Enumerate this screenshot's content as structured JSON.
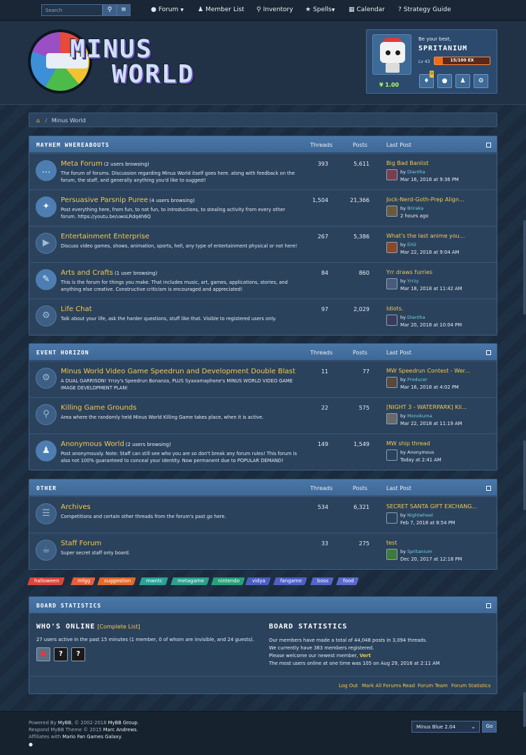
{
  "nav": {
    "search_placeholder": "Search",
    "items": [
      {
        "label": "Forum",
        "icon": "chat-bubbles-icon",
        "dropdown": true
      },
      {
        "label": "Member List",
        "icon": "users-icon",
        "dropdown": false
      },
      {
        "label": "Inventory",
        "icon": "flask-icon",
        "dropdown": false
      },
      {
        "label": "Spells",
        "icon": "star-icon",
        "dropdown": true
      },
      {
        "label": "Calendar",
        "icon": "calendar-icon",
        "dropdown": false
      },
      {
        "label": "Strategy Guide",
        "icon": "question-icon",
        "dropdown": false
      }
    ]
  },
  "logo": {
    "line1": "MINUS",
    "line2": "WORLD"
  },
  "user": {
    "tagline": "Be your best,",
    "name": "SPRITANIUM",
    "level": "Lv 43",
    "xp_text": "15/100 EX",
    "xp_fraction": 0.15,
    "money": "1.00",
    "notification_count": "0"
  },
  "breadcrumb": {
    "home_icon": "home-icon",
    "current": "Minus World"
  },
  "columns": {
    "threads": "Threads",
    "posts": "Posts",
    "last_post": "Last Post"
  },
  "sections": [
    {
      "title": "MAYHEM WHEREABOUTS",
      "forums": [
        {
          "name": "Meta Forum",
          "browsing": "(2 users browsing)",
          "desc": "The forum of forums. Discussion regarding Minus World itself goes here. along with feedback on the forum, the staff, and generally anything you'd like to suggest!",
          "threads": "393",
          "posts": "5,611",
          "lp_title": "Big Bad Banlist",
          "lp_user": "Diantha",
          "lp_date": "Mar 16, 2018 at 9:36 PM",
          "icon": "chat-icon"
        },
        {
          "name": "Persuasive Parsnip Puree",
          "browsing": "(4 users browsing)",
          "desc": "Post everything here, from fun, to not fun, to introductions, to stealing activity from every other forum. https://youtu.be/uwoLRdq4h6Q",
          "threads": "1,504",
          "posts": "21,366",
          "lp_title": "Jock-Nerd-Goth-Prep Align...",
          "lp_user": "Briraka",
          "lp_date": "2 hours ago",
          "icon": "magic-wand-icon"
        },
        {
          "name": "Entertainment Enterprise",
          "browsing": "",
          "desc": "Discuss video games, shows, animation, sports, hell, any type of entertainment physical or not here!",
          "threads": "267",
          "posts": "5,386",
          "lp_title": "What's the last anime you...",
          "lp_user": "EH2",
          "lp_date": "Mar 22, 2018 at 9:04 AM",
          "icon": "play-icon"
        },
        {
          "name": "Arts and Crafts",
          "browsing": "(1 user browsing)",
          "desc": "This is the forum for things you make. That includes music, art, games, applications, stories, and anything else creative. Constructive criticism is encouraged and appreciated!",
          "threads": "84",
          "posts": "860",
          "lp_title": "Yrr draws furries",
          "lp_user": "Yrrzy",
          "lp_date": "Mar 18, 2018 at 11:42 AM",
          "icon": "paintbrush-icon"
        },
        {
          "name": "Life Chat",
          "browsing": "",
          "desc": "Talk about your life, ask the harder questions, stuff like that. Visible to registered users only.",
          "threads": "97",
          "posts": "2,029",
          "lp_title": "Idiots.",
          "lp_user": "Diantha",
          "lp_date": "Mar 20, 2018 at 10:04 PM",
          "icon": "gear-icon"
        }
      ]
    },
    {
      "title": "EVENT HORIZON",
      "forums": [
        {
          "name": "Minus World Video Game Speedrun and Development Double Blast",
          "browsing": "",
          "desc": "A DUAL GARRISON! Yrrzy's Speedrun Bonanza, PLUS Syaxamaphone's MINUS WORLD VIDEO GAME IMAGE DEVELOPMENT PLAN!",
          "threads": "11",
          "posts": "77",
          "lp_title": "MW Speedrun Contest - Wer...",
          "lp_user": "Producer",
          "lp_date": "Mar 16, 2018 at 4:02 PM",
          "icon": "gear-icon"
        },
        {
          "name": "Killing Game Grounds",
          "browsing": "",
          "desc": "Area where the randomly held Minus World Killing Game takes place, when it is active.",
          "threads": "22",
          "posts": "575",
          "lp_title": "[NIGHT 3 - WATERPARK] Kil...",
          "lp_user": "Monokuma",
          "lp_date": "Mar 22, 2018 at 11:19 AM",
          "icon": "search-icon"
        },
        {
          "name": "Anonymous World",
          "browsing": "(2 users browsing)",
          "desc": "Post anonymously. Note: Staff can still see who you are so don't break any forum rules! This forum is also not 100% guaranteed to conceal your identity. Now permanent due to POPULAR DEMAND!",
          "threads": "149",
          "posts": "1,549",
          "lp_title": "MW ship thread",
          "lp_user": "Anonymous",
          "lp_date": "Today at 2:41 AM",
          "icon": "spy-icon"
        }
      ]
    },
    {
      "title": "OTHER",
      "forums": [
        {
          "name": "Archives",
          "browsing": "",
          "desc": "Competitions and certain other threads from the forum's past go here.",
          "threads": "534",
          "posts": "6,321",
          "lp_title": "SECRET SANTA GIFT EXCHANG...",
          "lp_user": "Nightwheel",
          "lp_date": "Feb 7, 2018 at 8:54 PM",
          "icon": "document-icon"
        },
        {
          "name": "Staff Forum",
          "browsing": "",
          "desc": "Super secret staff only board.",
          "threads": "33",
          "posts": "275",
          "lp_title": "test",
          "lp_user": "Spritanium",
          "lp_date": "Dec 20, 2017 at 12:18 PM",
          "icon": "coffee-icon"
        }
      ]
    }
  ],
  "tags": [
    {
      "label": "halloween",
      "color": "#d9463b"
    },
    {
      "label": "mfgg",
      "color": "#e2603a"
    },
    {
      "label": "suggestion",
      "color": "#e26a2c"
    },
    {
      "label": "mwntc",
      "color": "#2aa198"
    },
    {
      "label": "metagame",
      "color": "#2c9f8f"
    },
    {
      "label": "nintendo",
      "color": "#27a07a"
    },
    {
      "label": "vidya",
      "color": "#4a5fc1"
    },
    {
      "label": "fangame",
      "color": "#4d62c4"
    },
    {
      "label": "boss",
      "color": "#5465c8"
    },
    {
      "label": "food",
      "color": "#5a6acb"
    }
  ],
  "stats": {
    "title": "BOARD STATISTICS",
    "online_title": "WHO'S ONLINE",
    "complete_list": "[Complete List]",
    "online_text": "27 users active in the past 15 minutes (1 member, 0 of whom are invisible, and 24 guests).",
    "board_title": "BOARD STATISTICS",
    "line1": "Our members have made a total of 44,048 posts in 3,094 threads.",
    "line2": "We currently have 383 members registered.",
    "line3_prefix": "Please welcome our newest member, ",
    "newest_member": "Vert",
    "line4": "The most users online at one time was 105 on Aug 29, 2016 at 2:11 AM",
    "links": [
      "Log Out",
      "Mark All Forums Read",
      "Forum Team",
      "Forum Statistics"
    ]
  },
  "footer": {
    "line1_prefix": "Powered By ",
    "line1_brand": "MyBB",
    "line1_suffix": ", © 2002-2018 ",
    "line1_group": "MyBB Group",
    "line2_prefix": "Respond MyBB Theme © 2015 ",
    "line2_author": "Marc Andrews",
    "line3_prefix": "Affiliates with ",
    "line3_affiliate": "Mario Fan Games Galaxy",
    "theme_value": "Minus Blue 2.04",
    "go_label": "Go"
  }
}
